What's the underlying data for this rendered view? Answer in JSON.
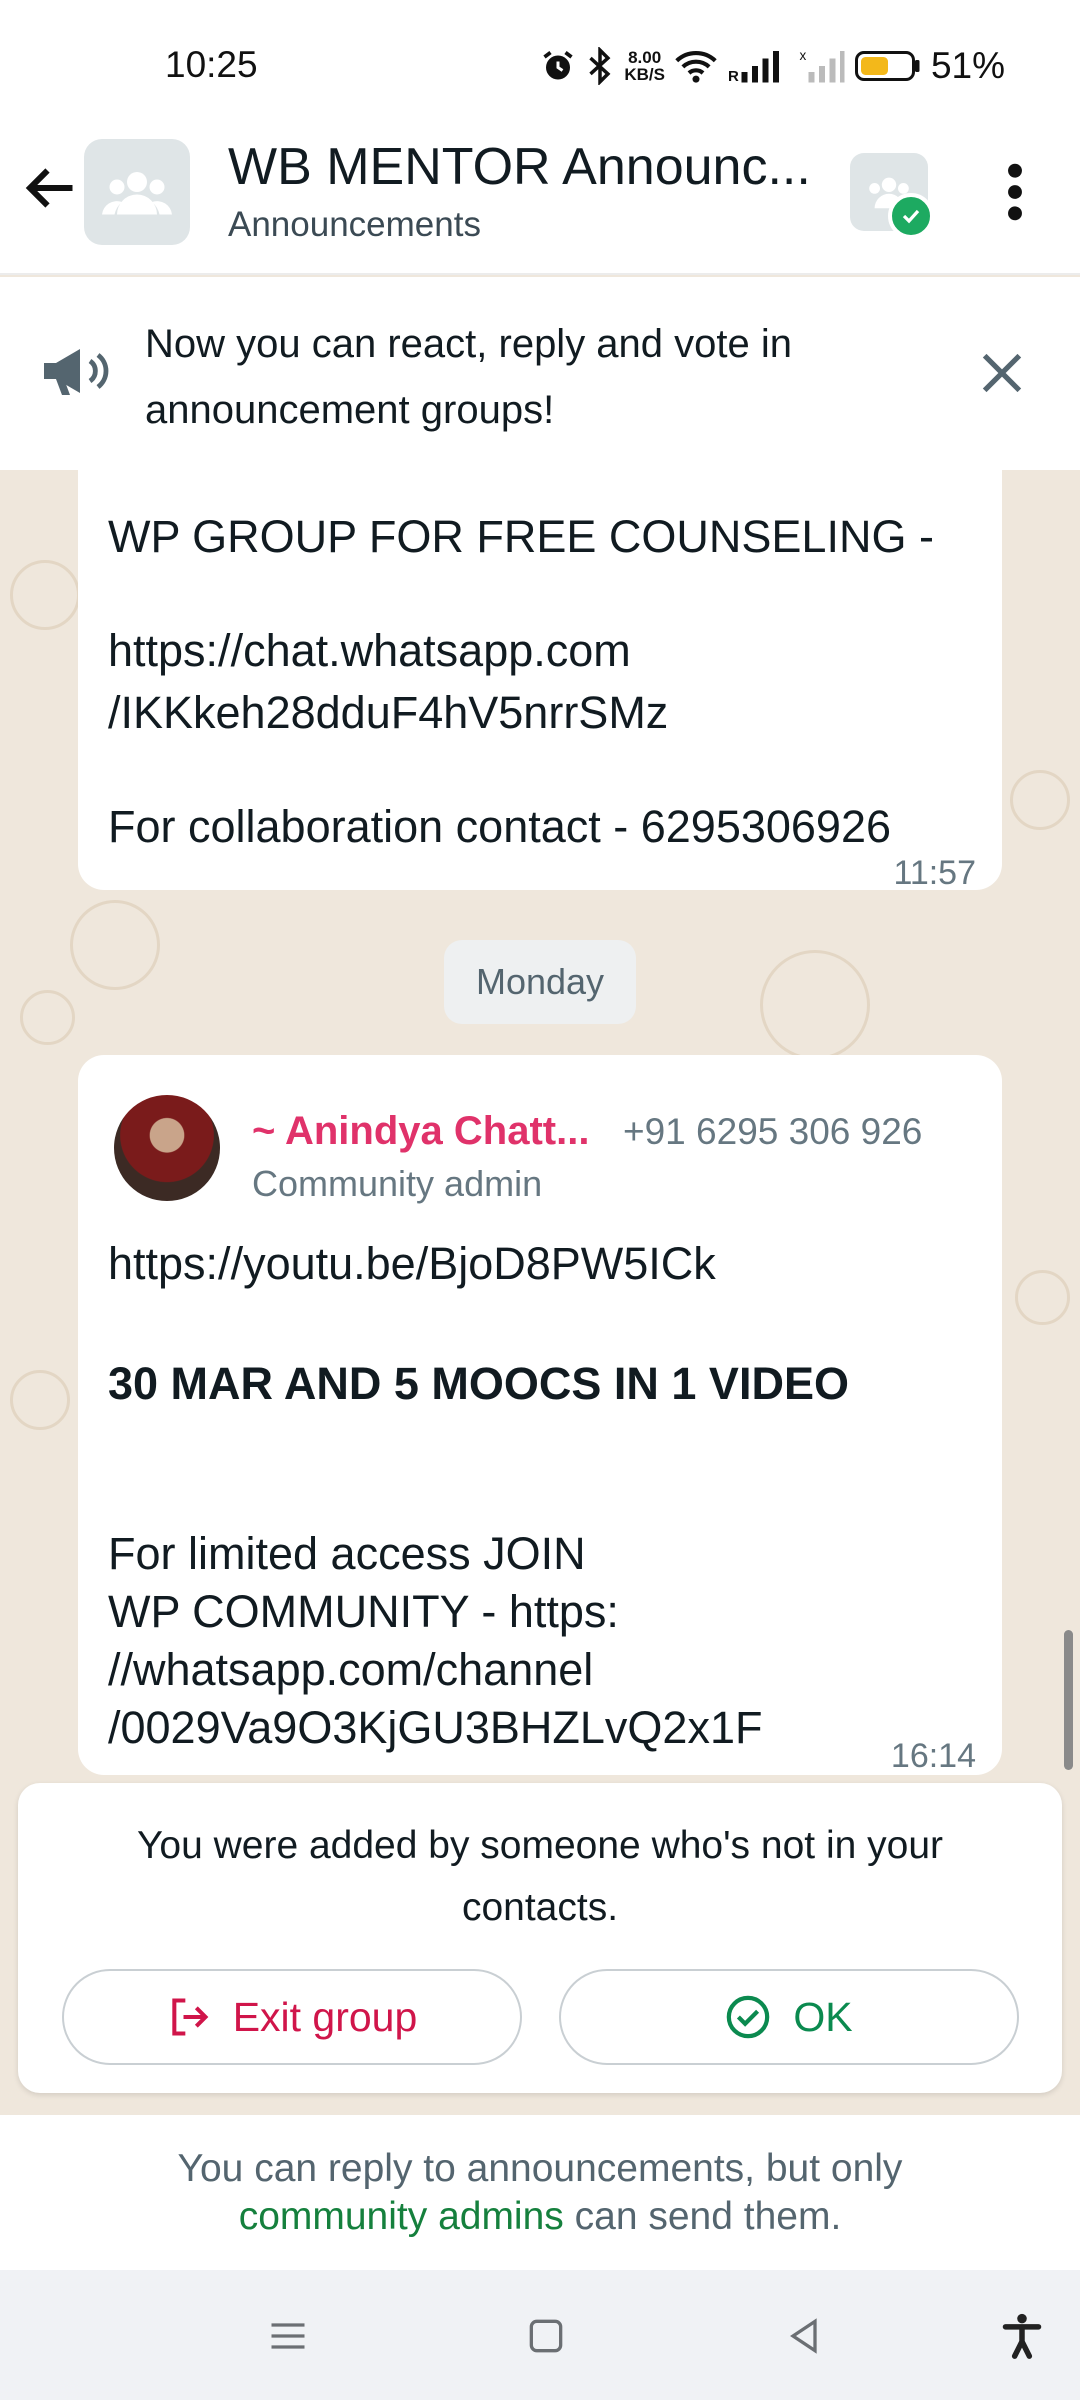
{
  "status_bar": {
    "time": "10:25",
    "net_speed_value": "8.00",
    "net_speed_unit": "KB/S",
    "battery_percent": "51%",
    "icons": [
      "alarm-icon",
      "bluetooth-icon",
      "wifi-icon",
      "signal-icon",
      "no-signal-icon",
      "battery-icon"
    ]
  },
  "header": {
    "title": "WB MENTOR Announc...",
    "subtitle": "Announcements"
  },
  "banner": {
    "text": "Now you can react, reply and vote in announcement groups!"
  },
  "messages": [
    {
      "lines": [
        "WP GROUP FOR FREE COUNSELING -",
        "",
        "https://chat.whatsapp.com",
        "/IKKkeh28dduF4hV5nrrSMz",
        "",
        "For collaboration contact - 6295306926"
      ],
      "time": "11:57"
    },
    {
      "sender_name": "~ Anindya Chatt...",
      "sender_phone": "+91 6295 306 926",
      "sender_role": "Community admin",
      "line_link": "https://youtu.be/BjoD8PW5ICk",
      "line_bold": "30 MAR AND 5 MOOCS IN 1 VIDEO",
      "line_body": "For limited access JOIN\nWP COMMUNITY - https:\n//whatsapp.com/channel\n/0029Va9O3KjGU3BHZLvQ2x1F",
      "time": "16:14"
    }
  ],
  "day_separator": "Monday",
  "added_card": {
    "text": "You were added by someone who's not in your contacts.",
    "exit_label": "Exit group",
    "ok_label": "OK"
  },
  "footer_note": {
    "before": "You can reply to announcements, but only",
    "link": "community admins",
    "after": "can send them."
  },
  "colors": {
    "accent_green": "#1daa61",
    "danger_red": "#d0154a",
    "sender_pink": "#e0326a",
    "chat_bg": "#efe7dc"
  }
}
